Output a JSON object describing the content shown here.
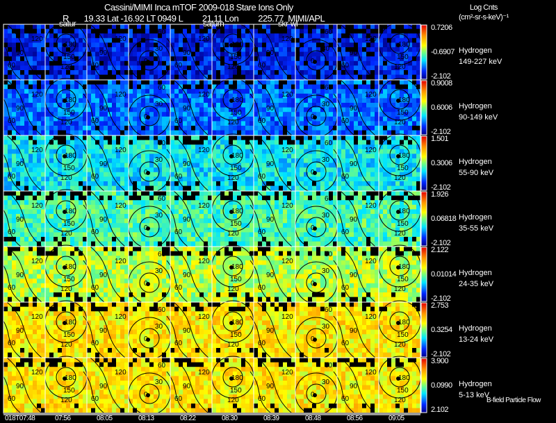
{
  "header": {
    "title": "Cassini/MIMI Inca mTOF  2009-018   Stare   Ions Only",
    "subtitle": "R       19.33 Lat -16.92 LT 0949 L         21.11 Lon         225.77  MIMI/APL",
    "units_line1": "Log Cnts",
    "units_line2": "(cm²-sr-s-keV)⁻¹"
  },
  "annotations": [
    "satur",
    "saturn",
    "skr-wl"
  ],
  "footer_label": "B-field Particle Flow",
  "chart_data": {
    "type": "heatmap",
    "x_tick_labels": [
      "018T07:48",
      "07:56",
      "08:05",
      "08:13",
      "08:22",
      "08:30",
      "08:39",
      "08:48",
      "08:56",
      "09:05"
    ],
    "contour_levels": [
      "0",
      "30",
      "60",
      "90",
      "120",
      "150",
      "180"
    ],
    "colormap": "rainbow (blue low → red high), black = no data",
    "panels": [
      {
        "species": "Hydrogen",
        "energy": "149-227 keV",
        "max": "0.7206",
        "mid": "-0.6907",
        "min": "-2.102",
        "level": 0.12
      },
      {
        "species": "Hydrogen",
        "energy": "90-149 keV",
        "max": "0.9008",
        "mid": "0.6006",
        "min": "-2.102",
        "level": 0.22
      },
      {
        "species": "Hydrogen",
        "energy": "55-90 keV",
        "max": "1.501",
        "mid": "0.3006",
        "min": "-2.102",
        "level": 0.36
      },
      {
        "species": "Hydrogen",
        "energy": "35-55 keV",
        "max": "1.926",
        "mid": "0.06818",
        "min": "-2.102",
        "level": 0.44
      },
      {
        "species": "Hydrogen",
        "energy": "24-35 keV",
        "max": "2.122",
        "mid": "0.01014",
        "min": "-2.102",
        "level": 0.56
      },
      {
        "species": "Hydrogen",
        "energy": "13-24 keV",
        "max": "2.753",
        "mid": "0.3254",
        "min": "-2.102",
        "level": 0.66
      },
      {
        "species": "Hydrogen",
        "energy": "5-13 keV",
        "max": "3.900",
        "mid": "0.0990",
        "min": "2.102",
        "level": 0.66
      }
    ]
  }
}
